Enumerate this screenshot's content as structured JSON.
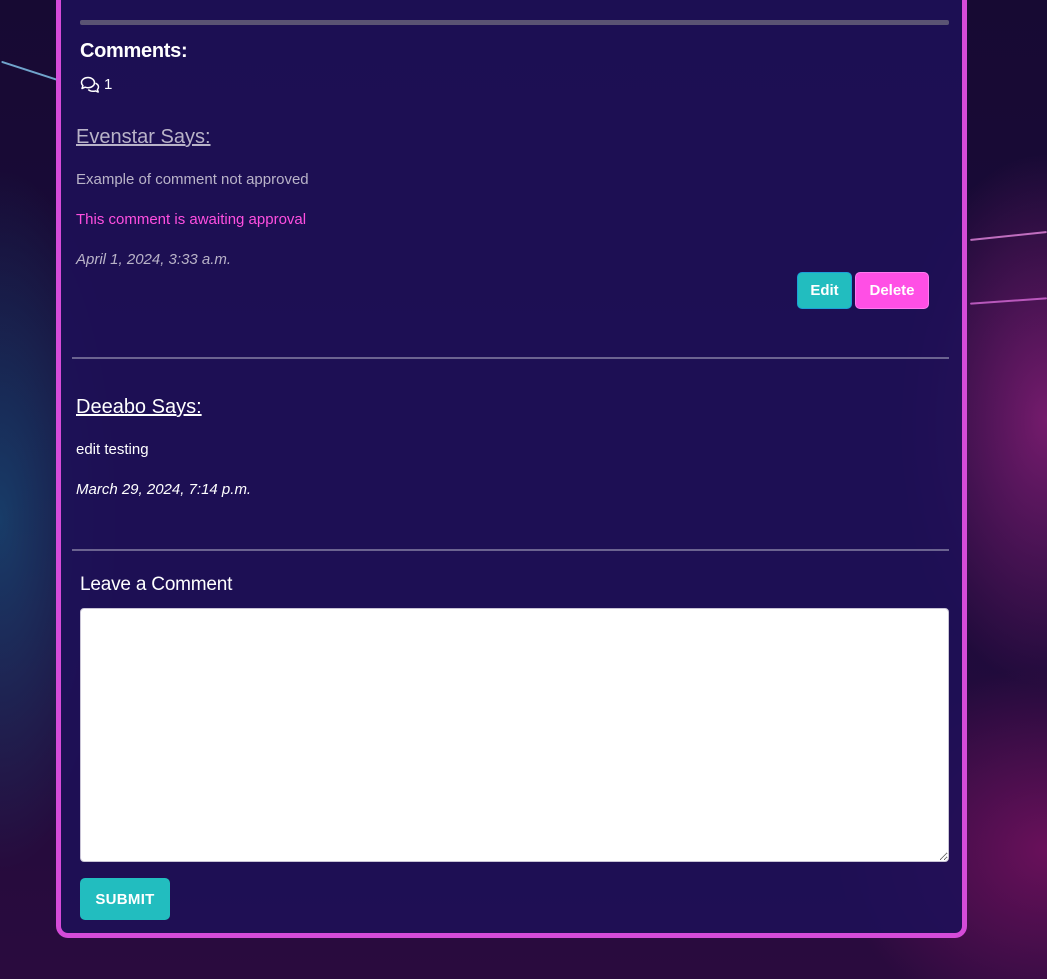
{
  "comments_section": {
    "heading": "Comments:",
    "count": "1",
    "count_icon": "speech-bubbles-icon"
  },
  "comments": [
    {
      "author": "Evenstar Says:",
      "body": "Example of comment not approved",
      "status": "This comment is awaiting approval",
      "date": "April 1, 2024, 3:33 a.m.",
      "edit_label": "Edit",
      "delete_label": "Delete"
    },
    {
      "author": "Deeabo Says:",
      "body": "edit testing",
      "date": "March 29, 2024, 7:14 p.m."
    }
  ],
  "comment_form": {
    "heading": "Leave a Comment",
    "value": "",
    "submit_label": "SUBMIT"
  },
  "colors": {
    "panel_border": "#d54bd9",
    "accent_teal": "#22bdbf",
    "accent_pink": "#ff4fe5",
    "pending_text": "#ff4fe0"
  }
}
